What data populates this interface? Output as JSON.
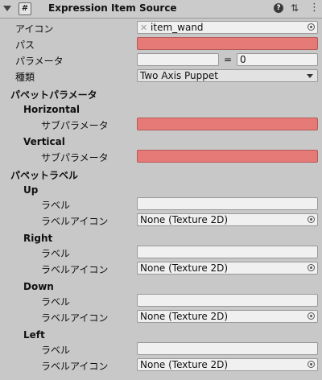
{
  "header": {
    "title": "Expression Item Source",
    "script_icon_glyph": "#",
    "help_glyph": "?",
    "preset_glyph": "⇅",
    "menu_glyph": "⋮"
  },
  "fields": {
    "icon": {
      "label": "アイコン",
      "value": "item_wand",
      "glyph": "✕"
    },
    "path": {
      "label": "パス",
      "value": ""
    },
    "parameter": {
      "label": "パラメータ",
      "value": "",
      "equals": "=",
      "number": "0"
    },
    "type": {
      "label": "種類",
      "value": "Two Axis Puppet"
    }
  },
  "puppet_parameters": {
    "section_title": "パペットパラメータ",
    "horizontal": {
      "title": "Horizontal",
      "sub_label": "サブパラメータ",
      "value": ""
    },
    "vertical": {
      "title": "Vertical",
      "sub_label": "サブパラメータ",
      "value": ""
    }
  },
  "puppet_labels": {
    "section_title": "パペットラベル",
    "up": {
      "title": "Up",
      "label_text": "ラベル",
      "label_value": "",
      "icon_text": "ラベルアイコン",
      "icon_value": "None (Texture 2D)"
    },
    "right": {
      "title": "Right",
      "label_text": "ラベル",
      "label_value": "",
      "icon_text": "ラベルアイコン",
      "icon_value": "None (Texture 2D)"
    },
    "down": {
      "title": "Down",
      "label_text": "ラベル",
      "label_value": "",
      "icon_text": "ラベルアイコン",
      "icon_value": "None (Texture 2D)"
    },
    "left": {
      "title": "Left",
      "label_text": "ラベル",
      "label_value": "",
      "icon_text": "ラベルアイコン",
      "icon_value": "None (Texture 2D)"
    }
  },
  "colors": {
    "missing_field": "#e57a77",
    "panel_background": "#c8c8c8",
    "field_background": "#f0f0f0"
  }
}
